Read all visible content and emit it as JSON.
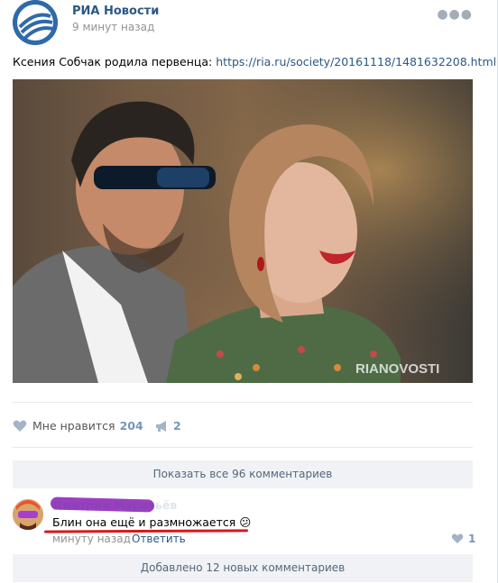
{
  "post": {
    "author": "РИА Новости",
    "time": "9 минут назад",
    "text": "Ксения Собчак родила первенца:",
    "link": "https://ria.ru/society/20161118/1481632208.html",
    "photo_watermark": "RIANOVOSTI"
  },
  "actions": {
    "like_label": "Мне нравится",
    "like_count": "204",
    "share_count": "2"
  },
  "comments": {
    "show_all_label": "Показать все 96 комментариев",
    "items": [
      {
        "author": "Дмитрий Муравьёв",
        "text": "Блин она ещё и размножается",
        "emoji": "😕",
        "time": "минуту назад",
        "reply_label": "Ответить",
        "likes": "1"
      }
    ],
    "new_comments_label": "Добавлено 12 новых комментариев"
  },
  "colors": {
    "link": "#2a5885",
    "accent": "#7596b8",
    "muted": "#939393",
    "bar_bg": "#f0f2f5"
  }
}
